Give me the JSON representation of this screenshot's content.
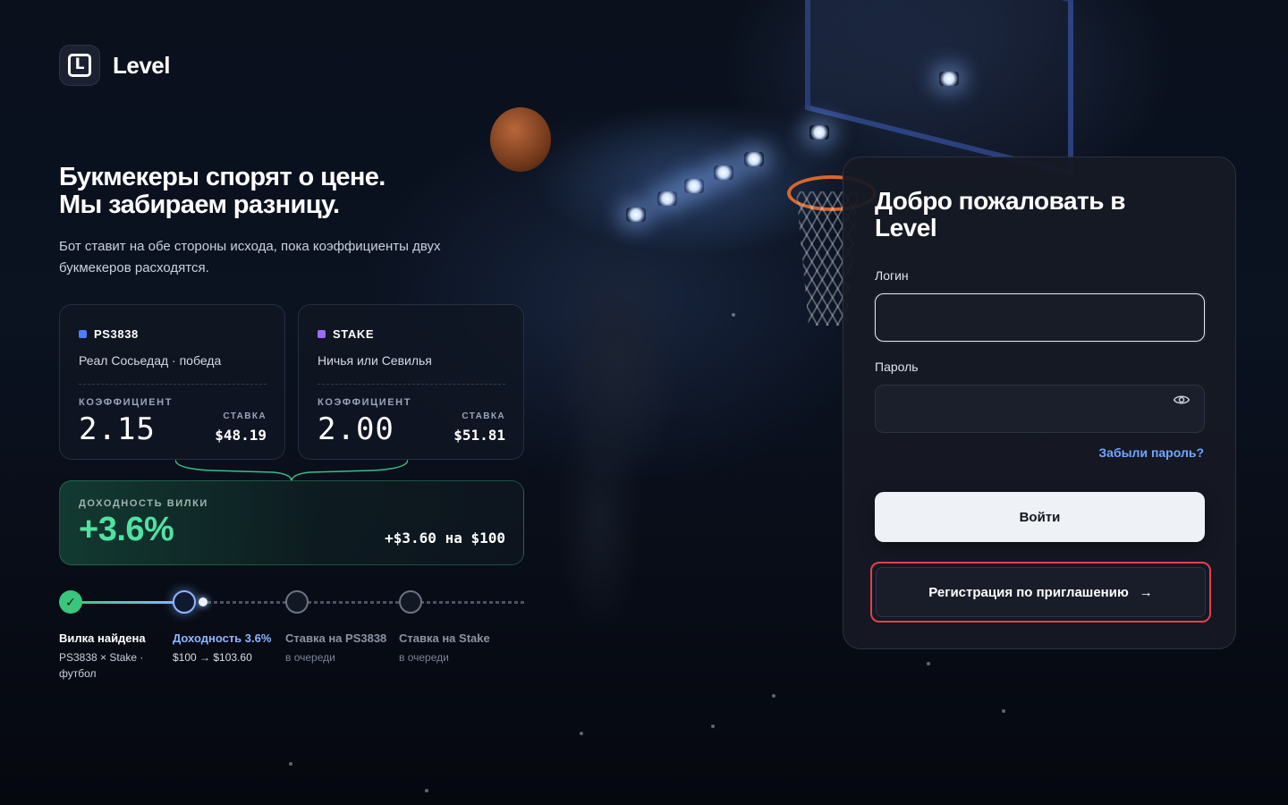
{
  "brand": {
    "name": "Level"
  },
  "hero": {
    "title_line1": "Букмекеры спорят о цене.",
    "title_line2": "Мы забираем разницу.",
    "subtitle": "Бот ставит на обе стороны исхода, пока коэффициенты двух букмекеров расходятся."
  },
  "bets": [
    {
      "bookmaker": "PS3838",
      "color": "#4f7dff",
      "event": "Реал Сосьедад · победа",
      "odds_label": "КОЭФФИЦИЕНТ",
      "odds": "2.15",
      "stake_label": "СТАВКА",
      "stake": "$48.19"
    },
    {
      "bookmaker": "STAKE",
      "color": "#9b6bff",
      "event": "Ничья или Севилья",
      "odds_label": "КОЭФФИЦИЕНТ",
      "odds": "2.00",
      "stake_label": "СТАВКА",
      "stake": "$51.81"
    }
  ],
  "yield": {
    "label": "ДОХОДНОСТЬ ВИЛКИ",
    "value": "+3.6%",
    "profit": "+$3.60 на $100"
  },
  "steps": [
    {
      "title": "Вилка найдена",
      "sub": "PS3838 × Stake · футбол",
      "state": "done"
    },
    {
      "title": "Доходность 3.6%",
      "sub": "$100 → $103.60",
      "state": "active"
    },
    {
      "title": "Ставка на PS3838",
      "sub": "в очереди",
      "state": "pending"
    },
    {
      "title": "Ставка на Stake",
      "sub": "в очереди",
      "state": "pending"
    }
  ],
  "login": {
    "title": "Добро пожаловать в Level",
    "login_label": "Логин",
    "login_value": "",
    "password_label": "Пароль",
    "password_value": "",
    "forgot": "Забыли пароль?",
    "submit": "Войти",
    "invite": "Регистрация по приглашению",
    "invite_arrow": "→"
  },
  "colors": {
    "accent_green": "#4ee3a0",
    "step_done": "#38c77c",
    "step_active": "#8fb6ff",
    "link": "#6fa7ff",
    "invite_highlight": "#e0414d"
  },
  "icons": [
    "logo-icon",
    "check-icon",
    "eye-icon",
    "arrow-right-icon"
  ]
}
